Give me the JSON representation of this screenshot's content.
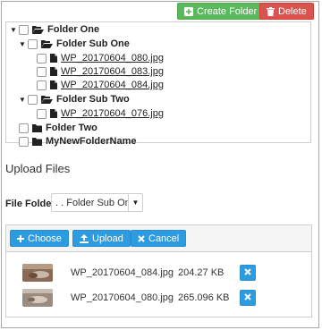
{
  "toolbar": {
    "create_folder_label": "Create Folder",
    "delete_label": "Delete"
  },
  "tree": {
    "folder_one": "Folder One",
    "folder_sub_one": "Folder Sub One",
    "files_sub_one": [
      "WP_20170604_080.jpg",
      "WP_20170604_083.jpg",
      "WP_20170604_084.jpg"
    ],
    "folder_sub_two": "Folder Sub Two",
    "files_sub_two": [
      "WP_20170604_076.jpg"
    ],
    "folder_two": "Folder Two",
    "my_new_folder": "MyNewFolderName"
  },
  "upload": {
    "title": "Upload Files",
    "file_folder_label": "File Folder",
    "file_folder_value": ". . Folder Sub One",
    "choose_label": "Choose",
    "upload_label": "Upload",
    "cancel_label": "Cancel",
    "files": [
      {
        "name": "WP_20170604_084.jpg",
        "size": "204.27 KB"
      },
      {
        "name": "WP_20170604_080.jpg",
        "size": "265.096 KB"
      }
    ]
  }
}
